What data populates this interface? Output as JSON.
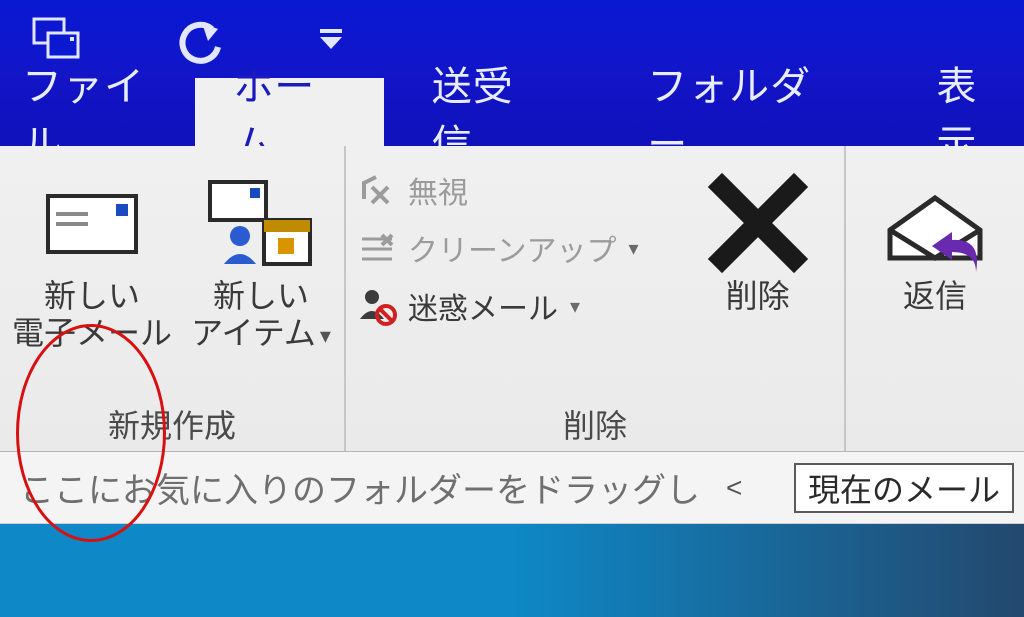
{
  "qat": {
    "app_icon": "outlook-icon",
    "undo_icon": "undo-icon",
    "customize_icon": "customize-icon"
  },
  "tabs": {
    "file": "ファイル",
    "home": "ホーム",
    "sendrecv": "送受信",
    "folder": "フォルダー",
    "view": "表示"
  },
  "groups": {
    "new": {
      "title": "新規作成",
      "new_email_l1": "新しい",
      "new_email_l2": "電子メール",
      "new_items_l1": "新しい",
      "new_items_l2": "アイテム"
    },
    "delete": {
      "title": "削除",
      "ignore": "無視",
      "cleanup": "クリーンアップ",
      "junk": "迷惑メール",
      "delete_btn": "削除"
    },
    "respond": {
      "reply": "返信"
    }
  },
  "favbar": {
    "placeholder": "ここにお気に入りのフォルダーをドラッグし"
  },
  "search": {
    "label": "現在のメール"
  }
}
